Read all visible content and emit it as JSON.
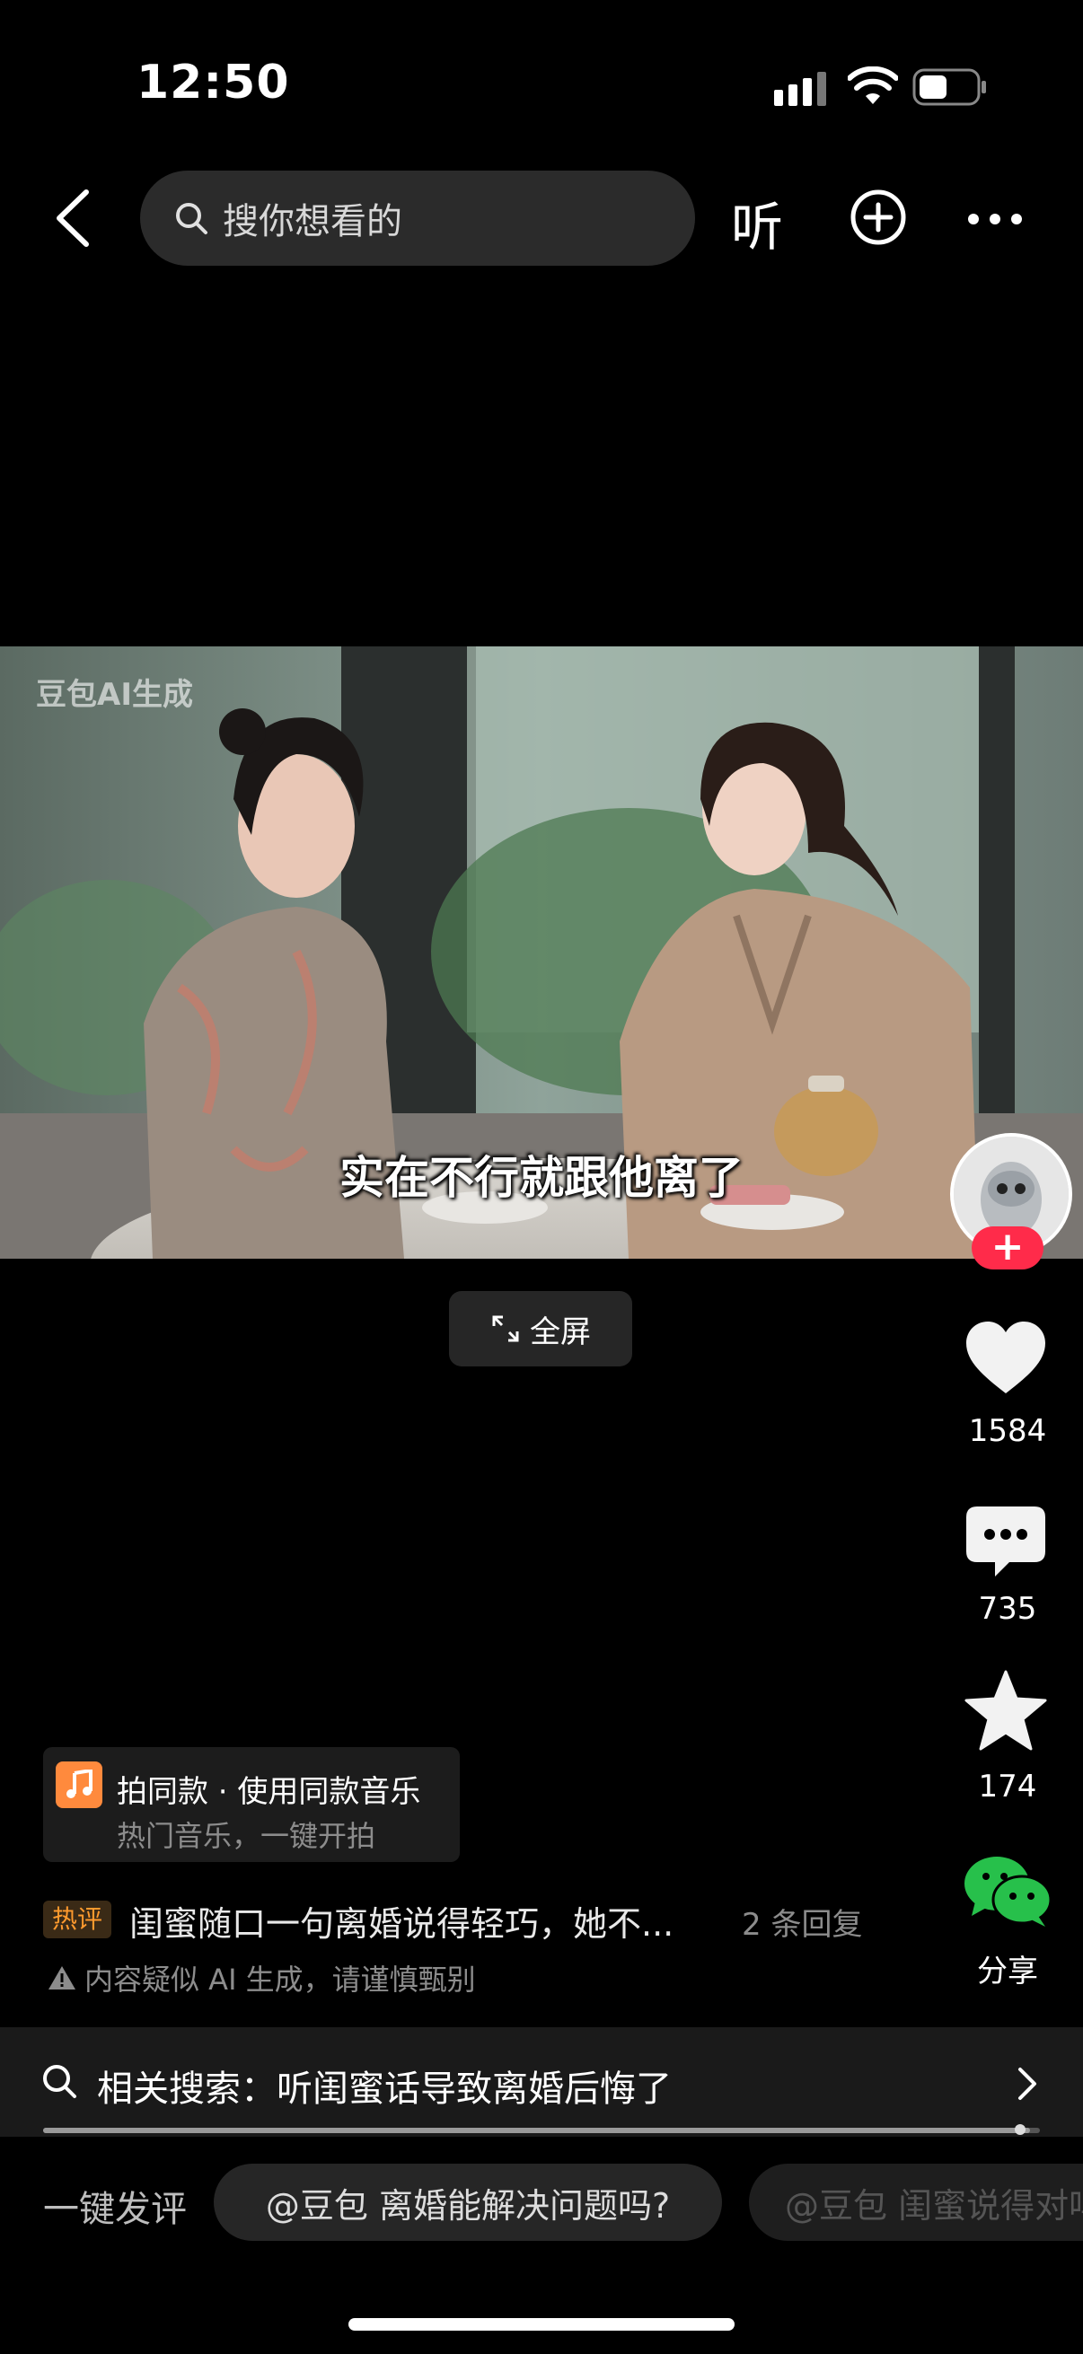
{
  "status": {
    "time": "12:50"
  },
  "topbar": {
    "search_placeholder": "搜你想看的",
    "listen_label": "听"
  },
  "video": {
    "watermark": "豆包AI生成",
    "subtitle": "实在不行就跟他离了",
    "fullscreen_label": "全屏"
  },
  "rail": {
    "likes": "1584",
    "comments": "735",
    "favorites": "174",
    "share_label": "分享"
  },
  "music": {
    "title": "拍同款 · 使用同款音乐",
    "subtitle": "热门音乐，一键开拍"
  },
  "hot_comment": {
    "badge": "热评",
    "text": "闺蜜随口一句离婚说得轻巧，她不...",
    "replies": "2 条回复"
  },
  "ai_notice": "内容疑似 AI 生成，请谨慎甄别",
  "related_search": {
    "text": "相关搜索：听闺蜜话导致离婚后悔了"
  },
  "progress": {
    "fraction": 0.99
  },
  "quick_comment": {
    "label": "一键发评",
    "chip1": "@豆包 离婚能解决问题吗?",
    "chip2": "@豆包 闺蜜说得对吗"
  },
  "colors": {
    "accent": "#ff2b4a",
    "hot": "#ff9a2e",
    "music": "#ff8a3d",
    "wechat": "#27c04b"
  }
}
